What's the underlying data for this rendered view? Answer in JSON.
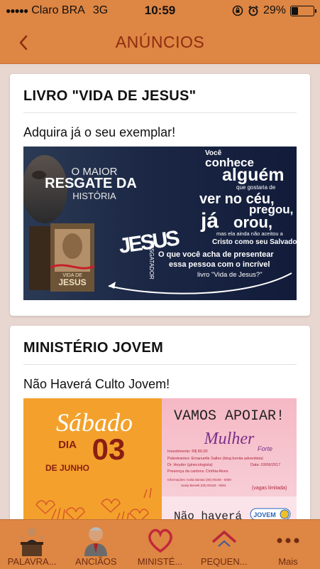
{
  "status": {
    "carrier": "Claro BRA",
    "network": "3G",
    "time": "10:59",
    "battery": "29%",
    "battery_level": 0.29
  },
  "nav": {
    "title": "ANÚNCIOS"
  },
  "cards": [
    {
      "title": "LIVRO \"VIDA DE JESUS\"",
      "text": "Adquira já o seu exemplar!",
      "image": {
        "left_a": "O MAIOR",
        "left_b": "RESGATE DA",
        "left_c": "HISTÓRIA",
        "r1": "Você",
        "r2": "conhece",
        "r3": "alguém",
        "r4": "que gostaria de",
        "r5": "ver no céu,",
        "r6": "já",
        "r7": "pregou,",
        "r8": "orou,",
        "r9": "mas ela ainda não aceitou a",
        "r10": "Cristo como seu Salvador?",
        "q1": "O que você acha de presentear",
        "q2": "essa pessoa com o incrível",
        "q3": "livro \"Vida de Jesus?\"",
        "book": "JESUS",
        "book_small": "VIDA DE",
        "big_word": "JESUS",
        "side_word": "RESGATADOR"
      }
    },
    {
      "title": "MINISTÉRIO JOVEM",
      "text": "Não Haverá Culto Jovem!",
      "image": {
        "day": "Sábado",
        "dia": "DIA",
        "num": "03",
        "month": "DE JUNHO",
        "apoiar": "VAMOS APOIAR!",
        "brand": "Mulher",
        "brand2": "Forte",
        "l1": "Investimento: R$ 80,00",
        "l2": "Palestrantes: Emanuelle Salles (blog bonita adventista)",
        "l3": "Dr. Heyder (ginecologista)",
        "l4": "Presença da cantora: Cinthia Alves",
        "date": "Data: 03/06/2017",
        "l5": "Informações: Kalia Dantas (00) 00106 - 0000",
        "l6": "Suely Benetti (00) 00153 - 0004",
        "vagas": "(vagas limitada)",
        "nao": "Não haverá",
        "jovem": "JOVEM"
      }
    }
  ],
  "tabs": [
    {
      "label": "PALAVRA...",
      "icon": "pastor-icon"
    },
    {
      "label": "ANCIÃOS",
      "icon": "elder-icon"
    },
    {
      "label": "MINISTÉ...",
      "icon": "heart-icon"
    },
    {
      "label": "PEQUEN...",
      "icon": "house-icon"
    },
    {
      "label": "Mais",
      "icon": "more-icon"
    }
  ],
  "colors": {
    "accent": "#de8643",
    "title": "#8a2e10",
    "background": "#e8d6d0",
    "tab_label": "#6e2c12"
  }
}
